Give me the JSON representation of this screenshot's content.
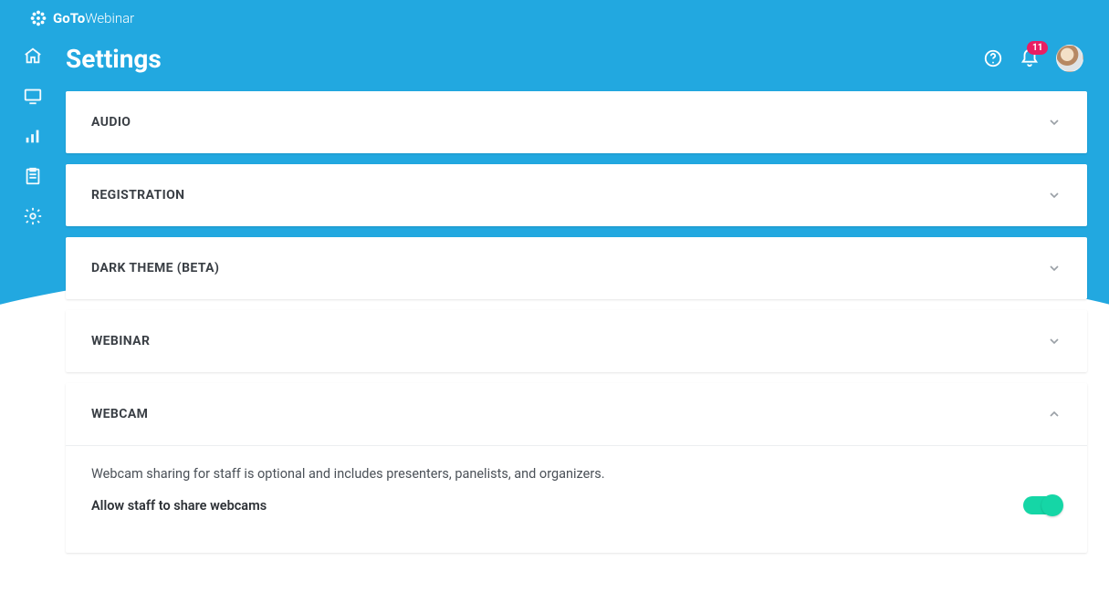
{
  "brand": {
    "bold": "GoTo",
    "light": "Webinar"
  },
  "page_title": "Settings",
  "notifications_count": "11",
  "sections": {
    "audio": {
      "title": "AUDIO",
      "expanded": false
    },
    "registration": {
      "title": "REGISTRATION",
      "expanded": false
    },
    "dark_theme": {
      "title": "DARK THEME (BETA)",
      "expanded": false
    },
    "webinar": {
      "title": "WEBINAR",
      "expanded": false
    },
    "webcam": {
      "title": "WEBCAM",
      "expanded": true,
      "description": "Webcam sharing for staff is optional and includes presenters, panelists, and organizers.",
      "setting_label": "Allow staff to share webcams",
      "setting_enabled": true
    }
  }
}
